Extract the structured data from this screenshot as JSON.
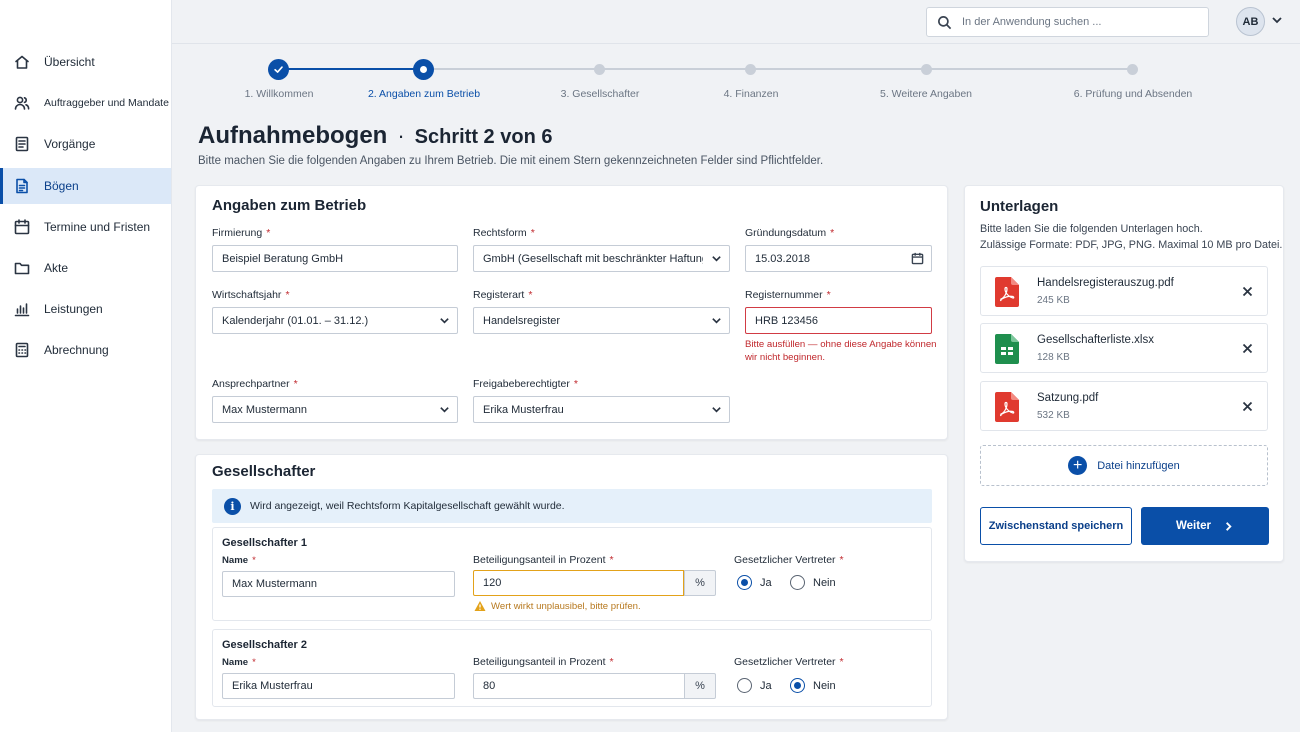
{
  "sidebar": {
    "items": [
      {
        "label": "Übersicht",
        "icon": "home-icon"
      },
      {
        "label": "Auftraggeber und Mandate",
        "icon": "users-icon"
      },
      {
        "label": "Vorgänge",
        "icon": "list-doc-icon"
      },
      {
        "label": "Bögen",
        "icon": "form-doc-icon",
        "active": true
      },
      {
        "label": "Termine und Fristen",
        "icon": "calendar-icon"
      },
      {
        "label": "Akte",
        "icon": "folder-icon"
      },
      {
        "label": "Leistungen",
        "icon": "bar-chart-icon"
      },
      {
        "label": "Abrechnung",
        "icon": "calculator-icon"
      }
    ]
  },
  "topbar": {
    "search_placeholder": "In der Anwendung suchen ...",
    "avatar_initials": "AB"
  },
  "stepper": {
    "steps": [
      {
        "label": "1. Willkommen",
        "state": "done"
      },
      {
        "label": "2. Angaben zum Betrieb",
        "state": "active"
      },
      {
        "label": "3. Gesellschafter",
        "state": "todo"
      },
      {
        "label": "4. Finanzen",
        "state": "todo"
      },
      {
        "label": "5. Weitere Angaben",
        "state": "todo"
      },
      {
        "label": "6. Prüfung und Absenden",
        "state": "todo"
      }
    ]
  },
  "page": {
    "title": "Aufnahmebogen",
    "separator": "·",
    "step_title": "Schritt 2 von 6",
    "subtitle": "Bitte machen Sie die folgenden Angaben zu Ihrem Betrieb. Die mit einem Stern gekennzeichneten Felder sind Pflichtfelder."
  },
  "betrieb": {
    "title": "Angaben zum Betrieb",
    "required_mark": "*",
    "firmierung": {
      "label": "Firmierung",
      "value": "Beispiel Beratung GmbH"
    },
    "rechtsform": {
      "label": "Rechtsform",
      "value": "GmbH (Gesellschaft mit beschränkter Haftung)"
    },
    "gruendungsdatum": {
      "label": "Gründungsdatum",
      "value": "15.03.2018"
    },
    "wirtschaftsjahr": {
      "label": "Wirtschaftsjahr",
      "value": "Kalenderjahr (01.01. – 31.12.)"
    },
    "registerart": {
      "label": "Registerart",
      "value": "Handelsregister"
    },
    "registernummer": {
      "label": "Registernummer",
      "value": "HRB 123456",
      "error": "Bitte ausfüllen — ohne diese Angabe können wir nicht beginnen."
    },
    "ansprechpartner": {
      "label": "Ansprechpartner",
      "value": "Max Mustermann"
    },
    "freigabe": {
      "label": "Freigabeberechtigter",
      "value": "Erika Musterfrau"
    }
  },
  "gesellschafter": {
    "title": "Gesellschafter",
    "info": "Wird angezeigt, weil Rechtsform Kapitalgesellschaft gewählt wurde.",
    "name_label": "Name",
    "share_label": "Beteiligungsanteil in Prozent",
    "unit": "%",
    "rep_label": "Gesetzlicher Vertreter",
    "yes": "Ja",
    "no": "Nein",
    "entries": [
      {
        "title": "Gesellschafter 1",
        "name": "Max Mustermann",
        "share": "120",
        "warning": "Wert wirkt unplausibel, bitte prüfen.",
        "rep": "yes"
      },
      {
        "title": "Gesellschafter 2",
        "name": "Erika Musterfrau",
        "share": "80",
        "rep": "no"
      }
    ]
  },
  "unterlagen": {
    "title": "Unterlagen",
    "desc1": "Bitte laden Sie die folgenden Unterlagen hoch.",
    "desc2": "Zulässige Formate: PDF, JPG, PNG. Maximal 10 MB pro Datei.",
    "files": [
      {
        "name": "Handelsregisterauszug.pdf",
        "size": "245 KB",
        "type": "pdf"
      },
      {
        "name": "Gesellschafterliste.xlsx",
        "size": "128 KB",
        "type": "sheet"
      },
      {
        "name": "Satzung.pdf",
        "size": "532 KB",
        "type": "pdf"
      }
    ],
    "add_label": "Datei hinzufügen",
    "save_label": "Zwischenstand speichern",
    "next_label": "Weiter"
  },
  "colors": {
    "primary": "#0a4fa8",
    "error": "#d13b44",
    "warning": "#e3a21a",
    "pdf": "#e03a2f",
    "sheet": "#1f8f4e"
  }
}
